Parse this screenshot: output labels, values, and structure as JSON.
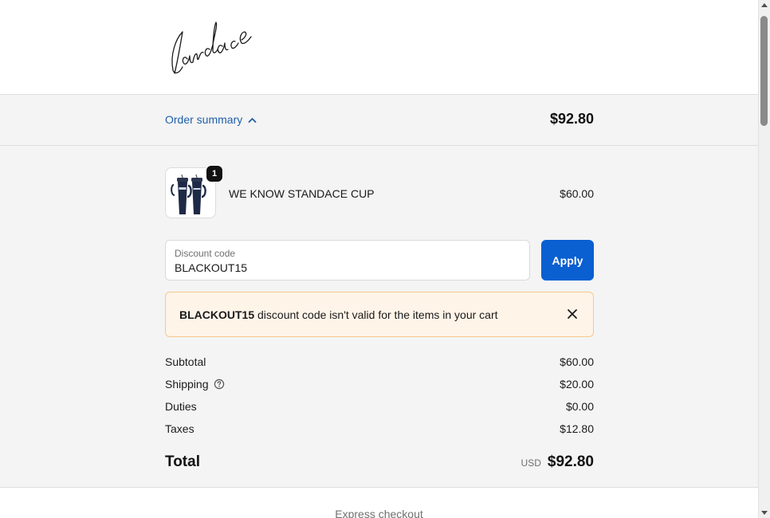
{
  "header": {
    "logo_text": "Candace"
  },
  "summary_bar": {
    "toggle_label": "Order summary",
    "total": "$92.80"
  },
  "line_item": {
    "quantity": "1",
    "name": "WE KNOW STANDACE CUP",
    "price": "$60.00",
    "image_icon": "tumbler-cups-image"
  },
  "discount": {
    "label": "Discount code",
    "value": "BLACKOUT15",
    "apply_label": "Apply"
  },
  "alert": {
    "code": "BLACKOUT15",
    "message": " discount code isn't valid for the items in your cart"
  },
  "costs": {
    "subtotal_label": "Subtotal",
    "subtotal_value": "$60.00",
    "shipping_label": "Shipping",
    "shipping_value": "$20.00",
    "duties_label": "Duties",
    "duties_value": "$0.00",
    "taxes_label": "Taxes",
    "taxes_value": "$12.80"
  },
  "total": {
    "label": "Total",
    "currency": "USD",
    "amount": "$92.80"
  },
  "express": {
    "label": "Express checkout"
  },
  "colors": {
    "accent": "#0a5fd1",
    "link": "#1f5fa8",
    "alert_bg": "#fff4e8",
    "alert_border": "#f5c98a"
  }
}
